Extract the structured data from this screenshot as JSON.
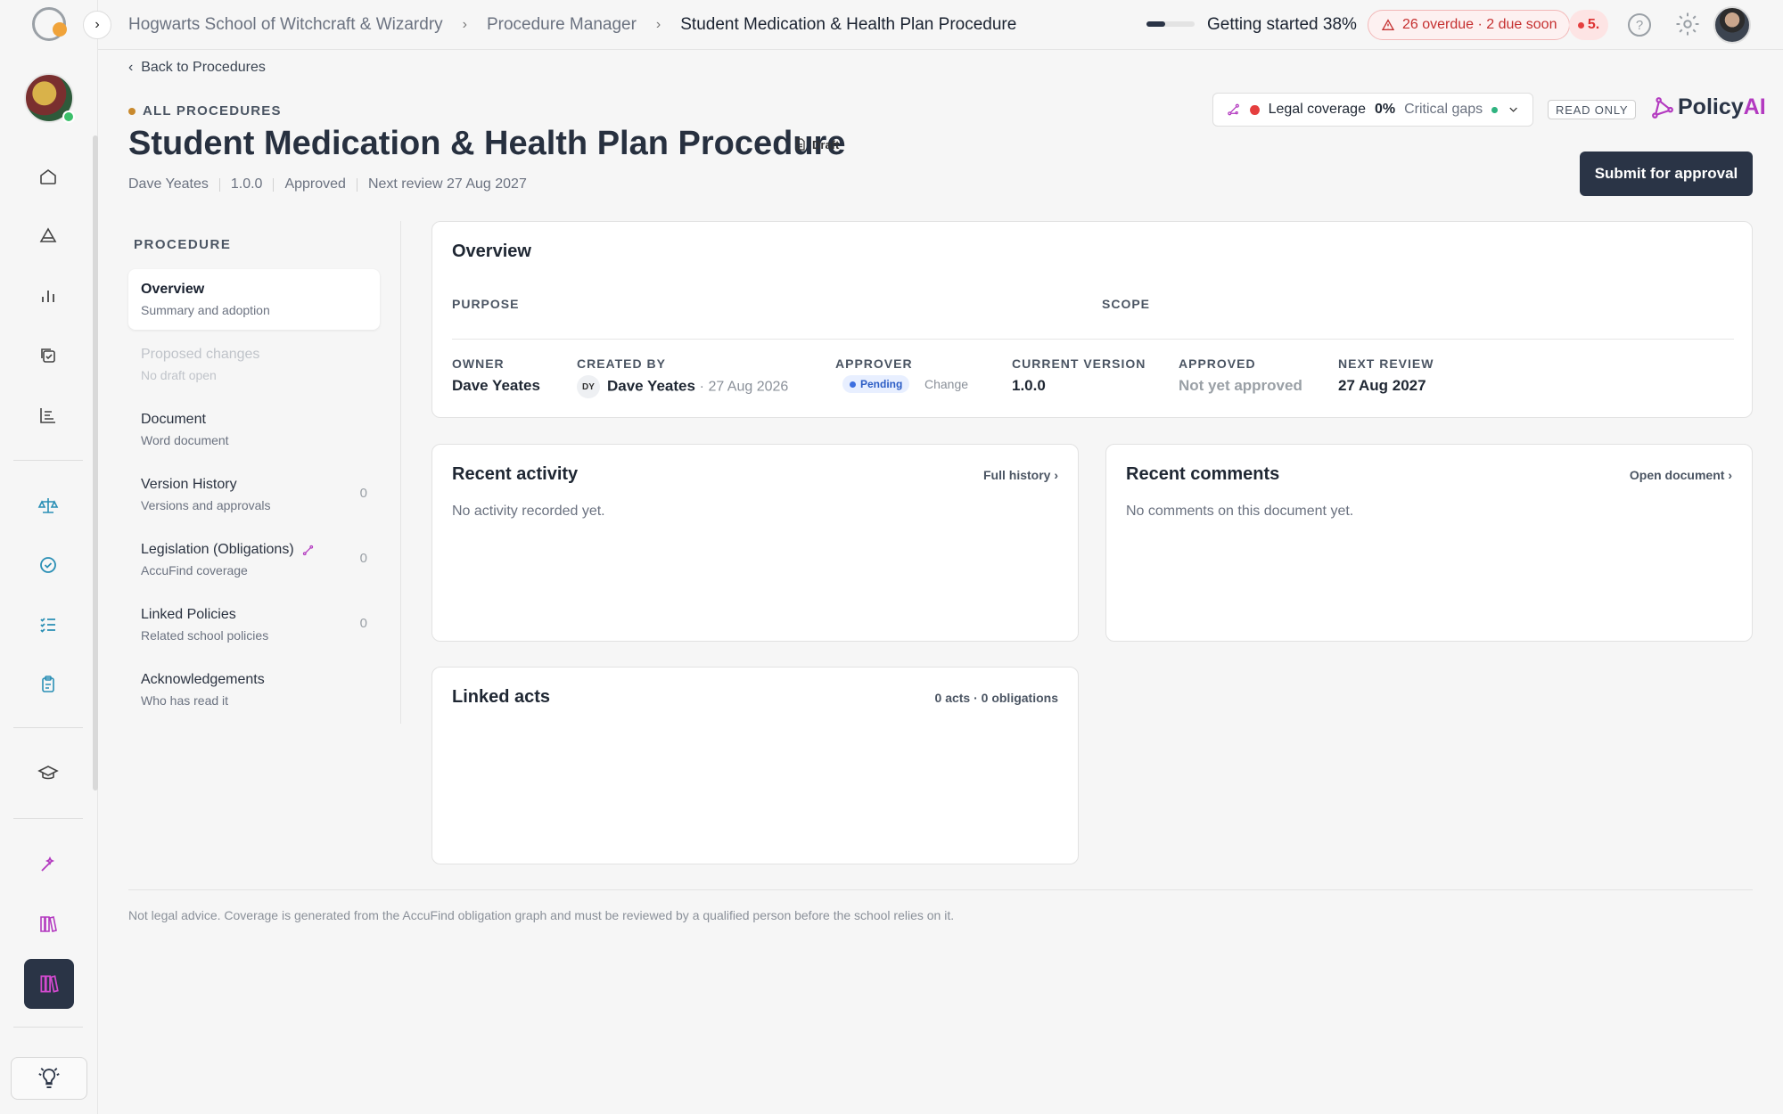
{
  "topbar": {
    "breadcrumbs": [
      "Hogwarts School of Witchcraft & Wizardry",
      "Procedure Manager",
      "Student Medication & Health Plan Procedure"
    ],
    "getting_started_label": "Getting started 38%",
    "getting_started_progress": 0.38,
    "overdue_label": "26 overdue · 2 due soon",
    "notification_label": "5."
  },
  "header": {
    "back_label": "Back to Procedures",
    "eyebrow": "ALL PROCEDURES",
    "title": "Student Medication & Health Plan Procedure",
    "draft_label": "Draft",
    "meta": [
      "Dave Yeates",
      "1.0.0",
      "Approved",
      "Next review 27 Aug 2027"
    ],
    "coverage_label": "Legal coverage",
    "coverage_value": "0%",
    "coverage_gaps": "Critical gaps",
    "readonly_label": "READ ONLY",
    "brand_main": "Policy",
    "brand_ai": "AI",
    "submit_label": "Submit for approval"
  },
  "procedure_nav": {
    "heading": "PROCEDURE",
    "items": [
      {
        "title": "Overview",
        "sub": "Summary and adoption",
        "count": ""
      },
      {
        "title": "Proposed changes",
        "sub": "No draft open",
        "count": ""
      },
      {
        "title": "Document",
        "sub": "Word document",
        "count": ""
      },
      {
        "title": "Version History",
        "sub": "Versions and approvals",
        "count": "0"
      },
      {
        "title": "Legislation (Obligations)",
        "sub": "AccuFind coverage",
        "count": "0"
      },
      {
        "title": "Linked Policies",
        "sub": "Related school policies",
        "count": "0"
      },
      {
        "title": "Acknowledgements",
        "sub": "Who has read it",
        "count": ""
      }
    ]
  },
  "overview": {
    "title": "Overview",
    "purpose_label": "PURPOSE",
    "scope_label": "SCOPE",
    "owner_label": "OWNER",
    "owner_value": "Dave Yeates",
    "created_label": "CREATED BY",
    "created_initials": "DY",
    "created_value": "Dave Yeates",
    "created_date": "· 27 Aug 2026",
    "approver_label": "APPROVER",
    "approver_status": "Pending",
    "approver_change": "Change",
    "version_label": "CURRENT VERSION",
    "version_value": "1.0.0",
    "approved_label": "APPROVED",
    "approved_value": "Not yet approved",
    "review_label": "NEXT REVIEW",
    "review_value": "27 Aug 2027"
  },
  "activity": {
    "title": "Recent activity",
    "link": "Full history ›",
    "empty": "No activity recorded yet."
  },
  "comments": {
    "title": "Recent comments",
    "link": "Open document ›",
    "empty": "No comments on this document yet."
  },
  "linked_acts": {
    "title": "Linked acts",
    "summary": "0 acts · 0 obligations"
  },
  "footer": {
    "note": "Not legal advice. Coverage is generated from the AccuFind obligation graph and must be reviewed by a qualified person before the school relies on it."
  },
  "colors": {
    "primary": "#2a3446",
    "danger": "#e53e3e",
    "brand_accent": "#b33ac0",
    "teal_icon": "#2a8fb5"
  }
}
